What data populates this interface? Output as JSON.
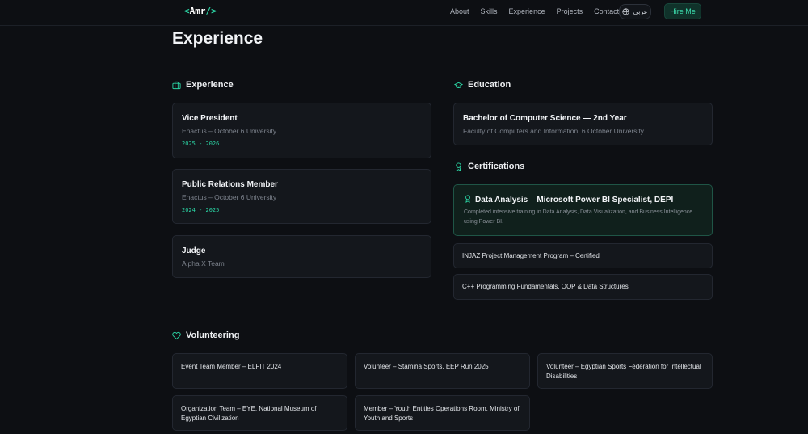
{
  "nav": {
    "logo_open": "<",
    "logo_name": "Amr",
    "logo_close": "/>",
    "links": [
      "About",
      "Skills",
      "Experience",
      "Projects",
      "Contact"
    ],
    "lang_label": "عربي",
    "lang_icon": "globe-icon",
    "hire_label": "Hire Me"
  },
  "page_title": "Experience",
  "experience": {
    "heading": "Experience",
    "icon": "briefcase-icon",
    "items": [
      {
        "title": "Vice President",
        "org": "Enactus – October 6 University",
        "years": "2025 - 2026"
      },
      {
        "title": "Public Relations Member",
        "org": "Enactus – October 6 University",
        "years": "2024 - 2025"
      },
      {
        "title": "Judge",
        "org": "Alpha X Team"
      }
    ]
  },
  "education": {
    "heading": "Education",
    "icon": "graduation-cap-icon",
    "degree": "Bachelor of Computer Science — 2nd Year",
    "faculty": "Faculty of Computers and Information, 6 October University"
  },
  "certifications": {
    "heading": "Certifications",
    "icon": "award-icon",
    "featured": {
      "title": "Data Analysis – Microsoft Power BI Specialist, DEPI",
      "description": "Completed intensive training in Data Analysis, Data Visualization, and Business Intelligence using Power BI."
    },
    "items": [
      "INJAZ Project Management Program – Certified",
      "C++ Programming Fundamentals, OOP & Data Structures"
    ]
  },
  "volunteering": {
    "heading": "Volunteering",
    "icon": "heart-icon",
    "items": [
      "Event Team Member – ELFIT 2024",
      "Volunteer – Stamina Sports, EEP Run 2025",
      "Volunteer – Egyptian Sports Federation for Intellectual Disabilities",
      "Organization Team – EYE, National Museum of Egyptian Civilization",
      "Member – Youth Entities Operations Room, Ministry of Youth and Sports"
    ]
  },
  "colors": {
    "accent": "#2bd4a4",
    "background": "#0d0f13",
    "card": "#14171c"
  }
}
